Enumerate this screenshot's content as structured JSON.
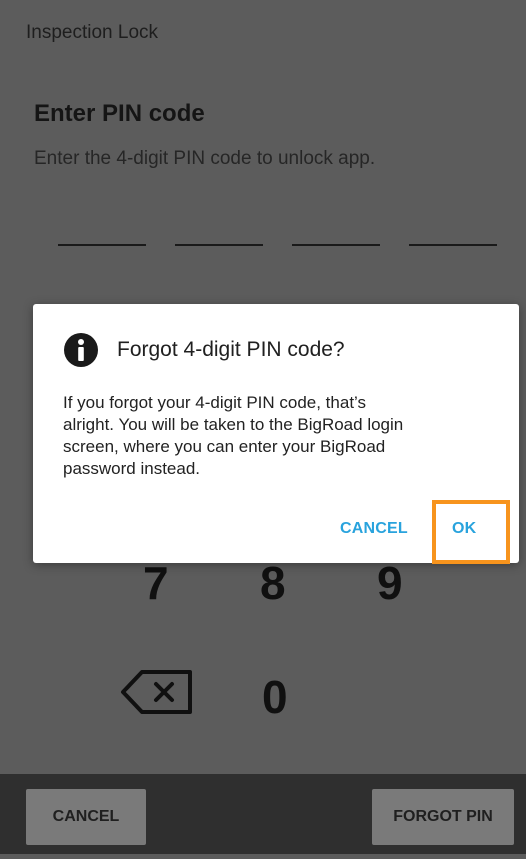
{
  "app_bar": {
    "title": "Inspection Lock"
  },
  "lock_screen": {
    "heading": "Enter PIN code",
    "subheading": "Enter the 4-digit PIN code to unlock app."
  },
  "keypad": {
    "keys": [
      "7",
      "8",
      "9",
      "0"
    ],
    "backspace_icon": "backspace-icon"
  },
  "bottom_bar": {
    "cancel_label": "CANCEL",
    "forgot_pin_label": "FORGOT PIN"
  },
  "dialog": {
    "icon": "info-icon",
    "title": "Forgot 4-digit PIN code?",
    "body_lines": [
      "If you forgot your 4-digit PIN code, that’s",
      "alright. You will be taken to the BigRoad login",
      "screen, where you can enter your BigRoad",
      "password instead."
    ],
    "cancel_label": "CANCEL",
    "ok_label": "OK"
  },
  "colors": {
    "accent": "#29a3dd",
    "highlight": "#f7941d",
    "scrim_background": "#5c5c5c",
    "bottom_bar": "#2f2f2f"
  }
}
